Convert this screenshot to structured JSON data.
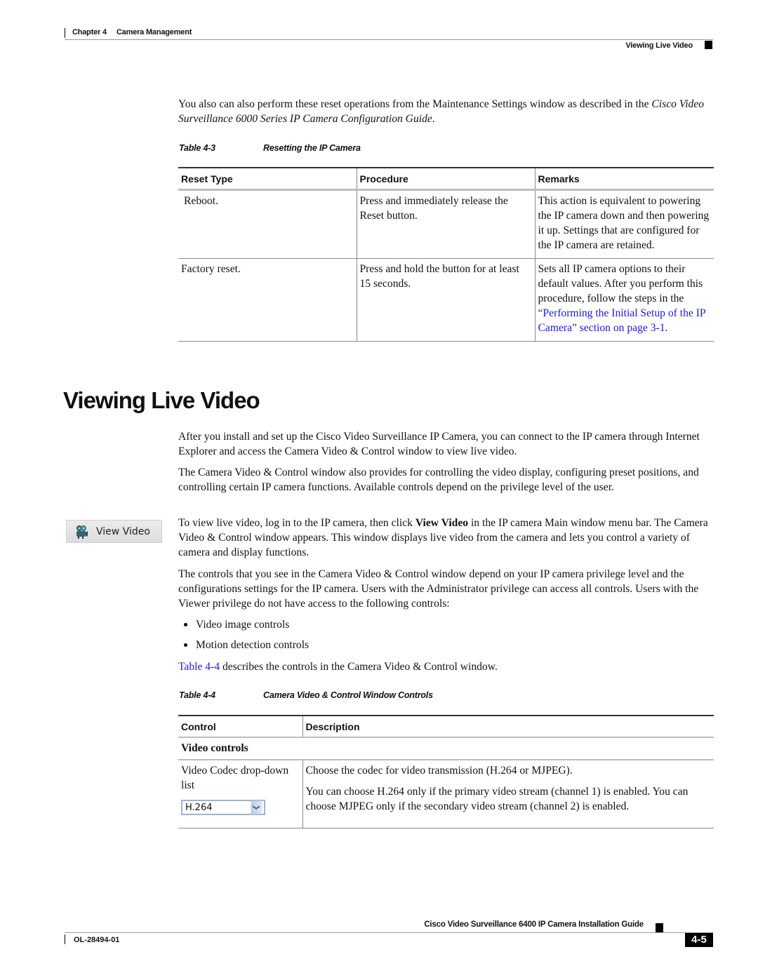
{
  "header": {
    "chapter": "Chapter 4",
    "chapter_title": "Camera Management",
    "section": "Viewing Live Video"
  },
  "intro_paragraph": {
    "before": "You also can also perform these reset operations from the Maintenance Settings window as described in the ",
    "italic": "Cisco Video Surveillance 6000 Series IP Camera Configuration Guide",
    "after": "."
  },
  "table_4_3": {
    "number": "Table 4-3",
    "title": "Resetting the IP Camera",
    "headers": [
      "Reset Type",
      "Procedure",
      "Remarks"
    ],
    "rows": [
      {
        "type": "Reboot.",
        "procedure": "Press and immediately release the Reset button.",
        "remarks": "This action is equivalent to powering the IP camera down and then powering it up. Settings that are configured for the IP camera are retained."
      },
      {
        "type": "Factory reset.",
        "procedure": "Press and hold the button for at least 15 seconds.",
        "remarks_before": "Sets all IP camera options to their default values. After you perform this procedure, follow the steps in the ",
        "remarks_link": "“Performing the Initial Setup of the IP Camera” section on page 3-1",
        "remarks_after": "."
      }
    ]
  },
  "section": {
    "heading": "Viewing Live Video",
    "paragraphs": [
      "After you install and set up the Cisco Video Surveillance IP Camera, you can connect to the IP camera through Internet Explorer and access the Camera Video & Control window to view live video.",
      "The Camera Video & Control window also provides for controlling the video display, configuring preset positions, and controlling certain IP camera functions. Available controls depend on the privilege level of the user."
    ],
    "view_video_para": {
      "before": "To view live video, log in to the IP camera, then click ",
      "bold": "View Video",
      "after": " in the IP camera Main window menu bar. The Camera Video & Control window appears. This window displays live video from the camera and lets you control a variety of camera and display functions."
    },
    "controls_para": "The controls that you see in the Camera Video & Control window depend on your IP camera privilege level and the configurations settings for the IP camera. Users with the Administrator privilege can access all controls. Users with the Viewer privilege do not have access to the following controls:",
    "bullets": [
      "Video image controls",
      "Motion detection controls"
    ],
    "table_ref": {
      "link": "Table 4-4",
      "after": " describes the controls in the Camera Video & Control window."
    }
  },
  "view_video_button": {
    "icon": "camera-icon",
    "label": "View Video"
  },
  "table_4_4": {
    "number": "Table 4-4",
    "title": "Camera Video & Control Window Controls",
    "headers": [
      "Control",
      "Description"
    ],
    "group": "Video controls",
    "rows": [
      {
        "control": "Video Codec drop-down list",
        "dropdown_value": "H.264",
        "description": [
          "Choose the codec for video transmission (H.264 or MJPEG).",
          "You can choose H.264 only if the primary video stream (channel 1) is enabled. You can choose MJPEG only if the secondary video stream (channel 2) is enabled."
        ]
      }
    ]
  },
  "footer": {
    "guide_title": "Cisco Video Surveillance 6400 IP Camera Installation Guide",
    "doc_number": "OL-28494-01",
    "page": "4-5"
  },
  "colors": {
    "link": "#1a1adf",
    "text": "#111111"
  }
}
